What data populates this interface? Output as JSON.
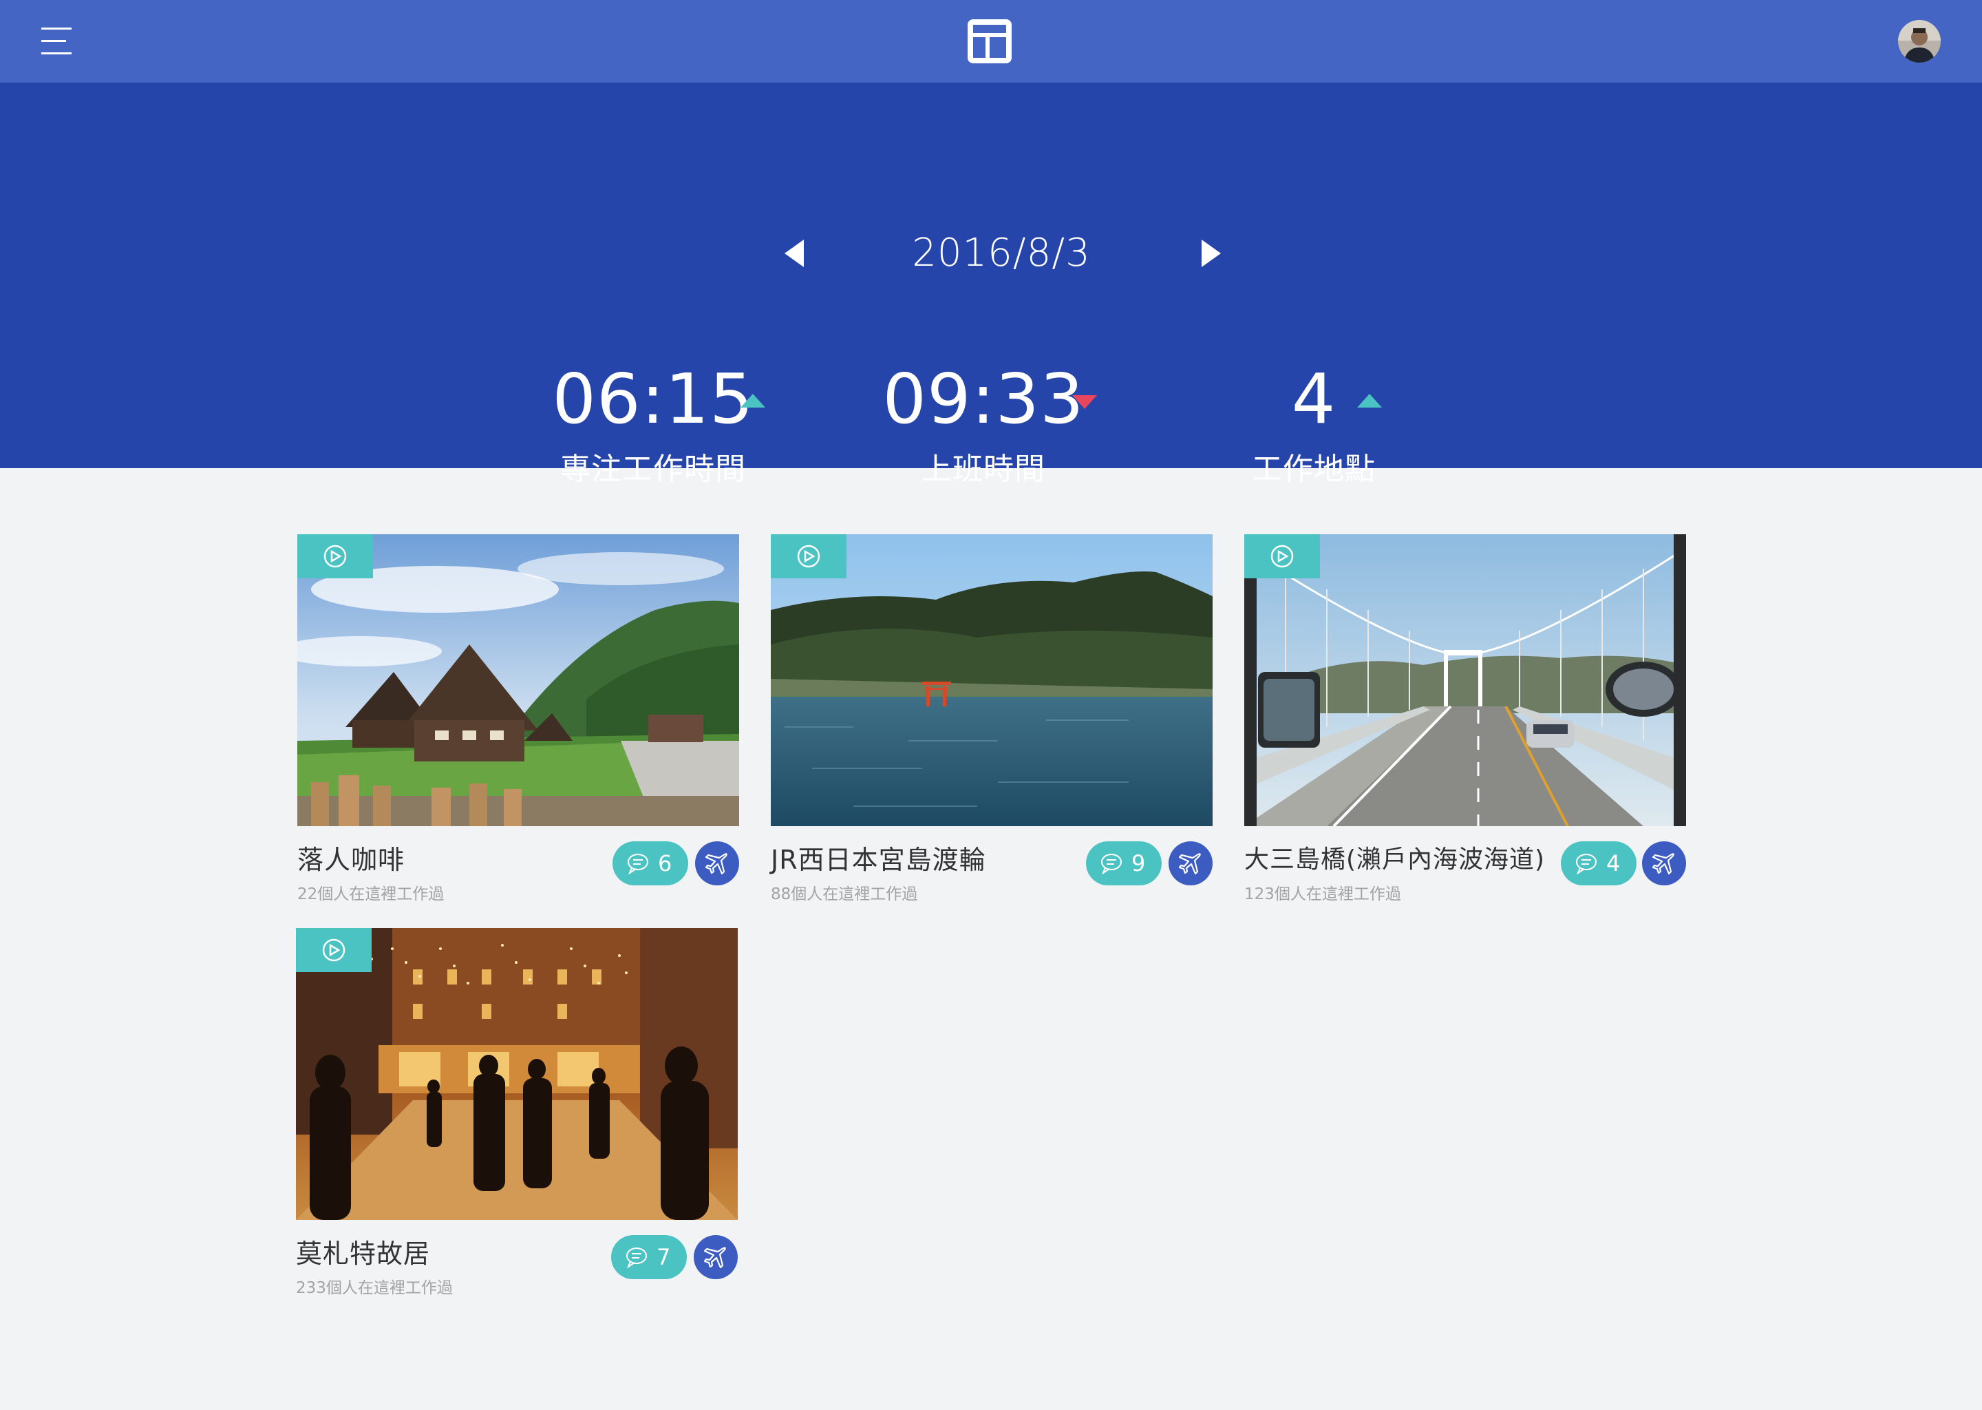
{
  "colors": {
    "topbar": "#4565c5",
    "hero": "#2545aa",
    "accent_teal": "#4cc3c3",
    "accent_blue": "#3d5cc2",
    "down_red": "#e8465c",
    "page_bg": "#f1f3f4"
  },
  "topbar": {
    "menu_icon": "hamburger-icon",
    "logo_icon": "grid-logo-icon",
    "avatar": "user-avatar"
  },
  "hero": {
    "date": "2016/8/3",
    "prev_icon": "triangle-left-icon",
    "next_icon": "triangle-right-icon",
    "stats": [
      {
        "value": "06:15",
        "label": "專注工作時間",
        "trend": "up"
      },
      {
        "value": "09:33",
        "label": "上班時間",
        "trend": "down"
      },
      {
        "value": "4",
        "label": "工作地點",
        "trend": "up"
      }
    ]
  },
  "cards": [
    {
      "title": "落人咖啡",
      "subtitle": "22個人在這裡工作過",
      "comments": "6",
      "photo": "thatched-village"
    },
    {
      "title": "JR西日本宮島渡輪",
      "subtitle": "88個人在這裡工作過",
      "comments": "9",
      "photo": "island-torii"
    },
    {
      "title": "大三島橋(瀨戶內海波海道)",
      "subtitle": "123個人在這裡工作過",
      "comments": "4",
      "photo": "bridge-road"
    },
    {
      "title": "莫札特故居",
      "subtitle": "233個人在這裡工作過",
      "comments": "7",
      "photo": "night-street"
    }
  ]
}
